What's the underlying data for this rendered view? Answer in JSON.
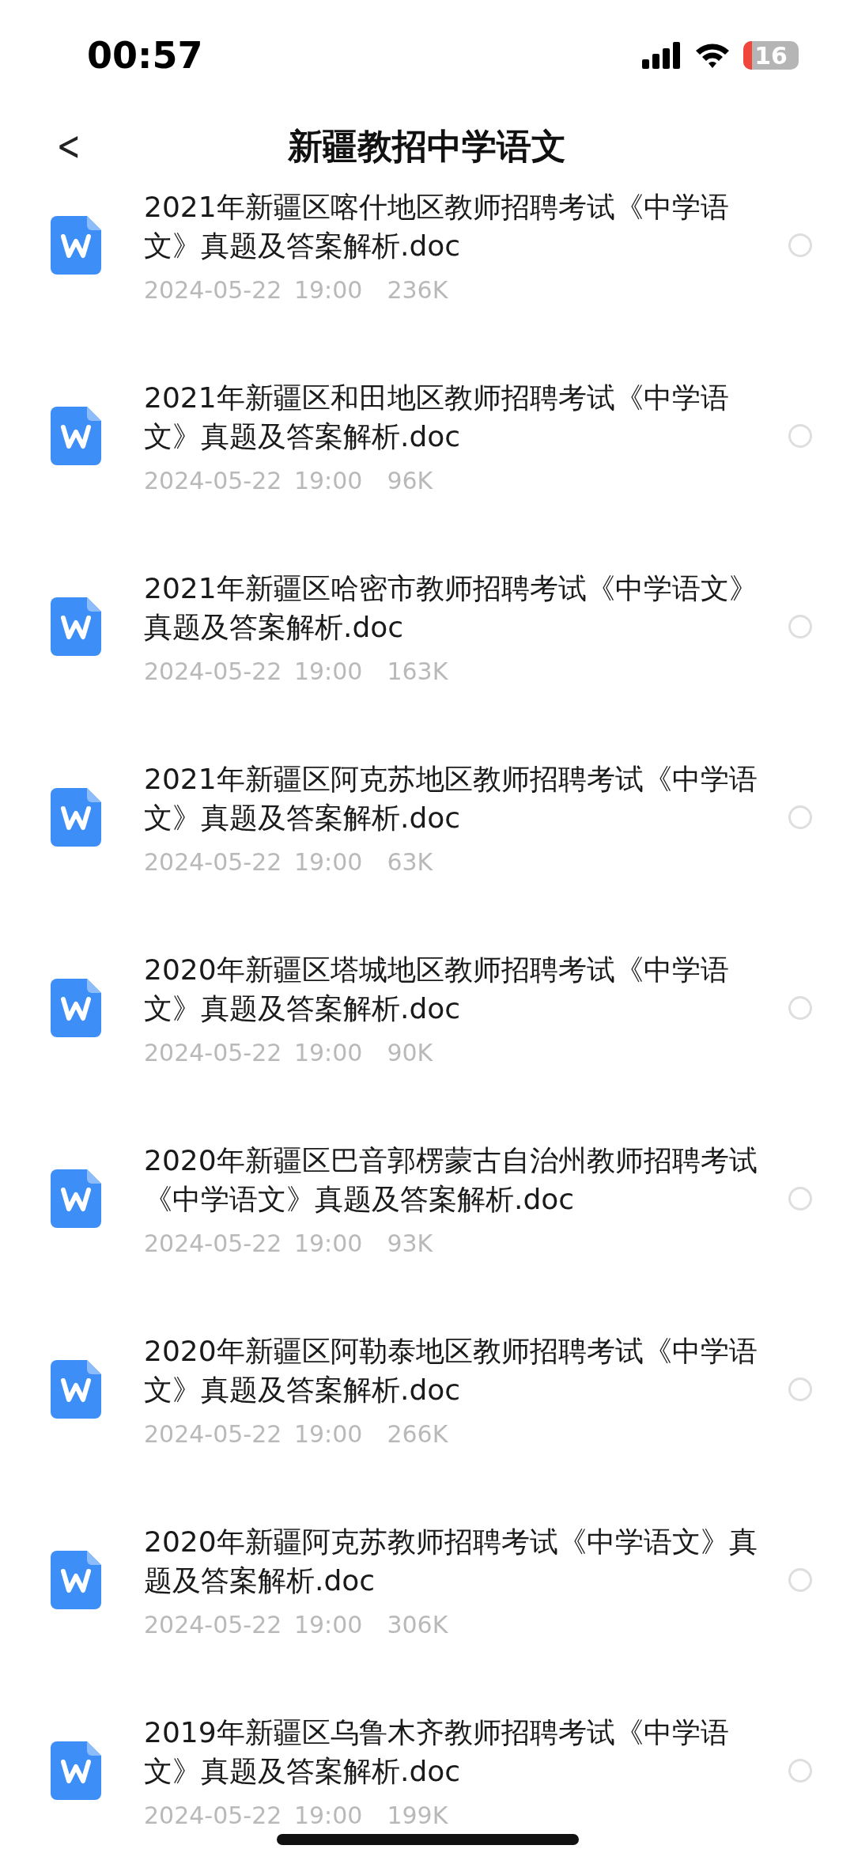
{
  "status_bar": {
    "time": "00:57",
    "battery": "16"
  },
  "nav": {
    "back": "<",
    "title": "新疆教招中学语文"
  },
  "files": [
    {
      "name": "2021年新疆区喀什地区教师招聘考试《中学语文》真题及答案解析.doc",
      "meta": "2024-05-22 19:00",
      "size": "236K",
      "selected": false
    },
    {
      "name": "2021年新疆区和田地区教师招聘考试《中学语文》真题及答案解析.doc",
      "meta": "2024-05-22 19:00",
      "size": "96K",
      "selected": false
    },
    {
      "name": "2021年新疆区哈密市教师招聘考试《中学语文》真题及答案解析.doc",
      "meta": "2024-05-22 19:00",
      "size": "163K",
      "selected": false
    },
    {
      "name": "2021年新疆区阿克苏地区教师招聘考试《中学语文》真题及答案解析.doc",
      "meta": "2024-05-22 19:00",
      "size": "63K",
      "selected": false
    },
    {
      "name": "2020年新疆区塔城地区教师招聘考试《中学语文》真题及答案解析.doc",
      "meta": "2024-05-22 19:00",
      "size": "90K",
      "selected": false
    },
    {
      "name": "2020年新疆区巴音郭楞蒙古自治州教师招聘考试《中学语文》真题及答案解析.doc",
      "meta": "2024-05-22 19:00",
      "size": "93K",
      "selected": false
    },
    {
      "name": "2020年新疆区阿勒泰地区教师招聘考试《中学语文》真题及答案解析.doc",
      "meta": "2024-05-22 19:00",
      "size": "266K",
      "selected": false
    },
    {
      "name": "2020年新疆阿克苏教师招聘考试《中学语文》真题及答案解析.doc",
      "meta": "2024-05-22 19:00",
      "size": "306K",
      "selected": false
    },
    {
      "name": "2019年新疆区乌鲁木齐教师招聘考试《中学语文》真题及答案解析.doc",
      "meta": "2024-05-22 19:00",
      "size": "199K",
      "selected": false
    }
  ]
}
